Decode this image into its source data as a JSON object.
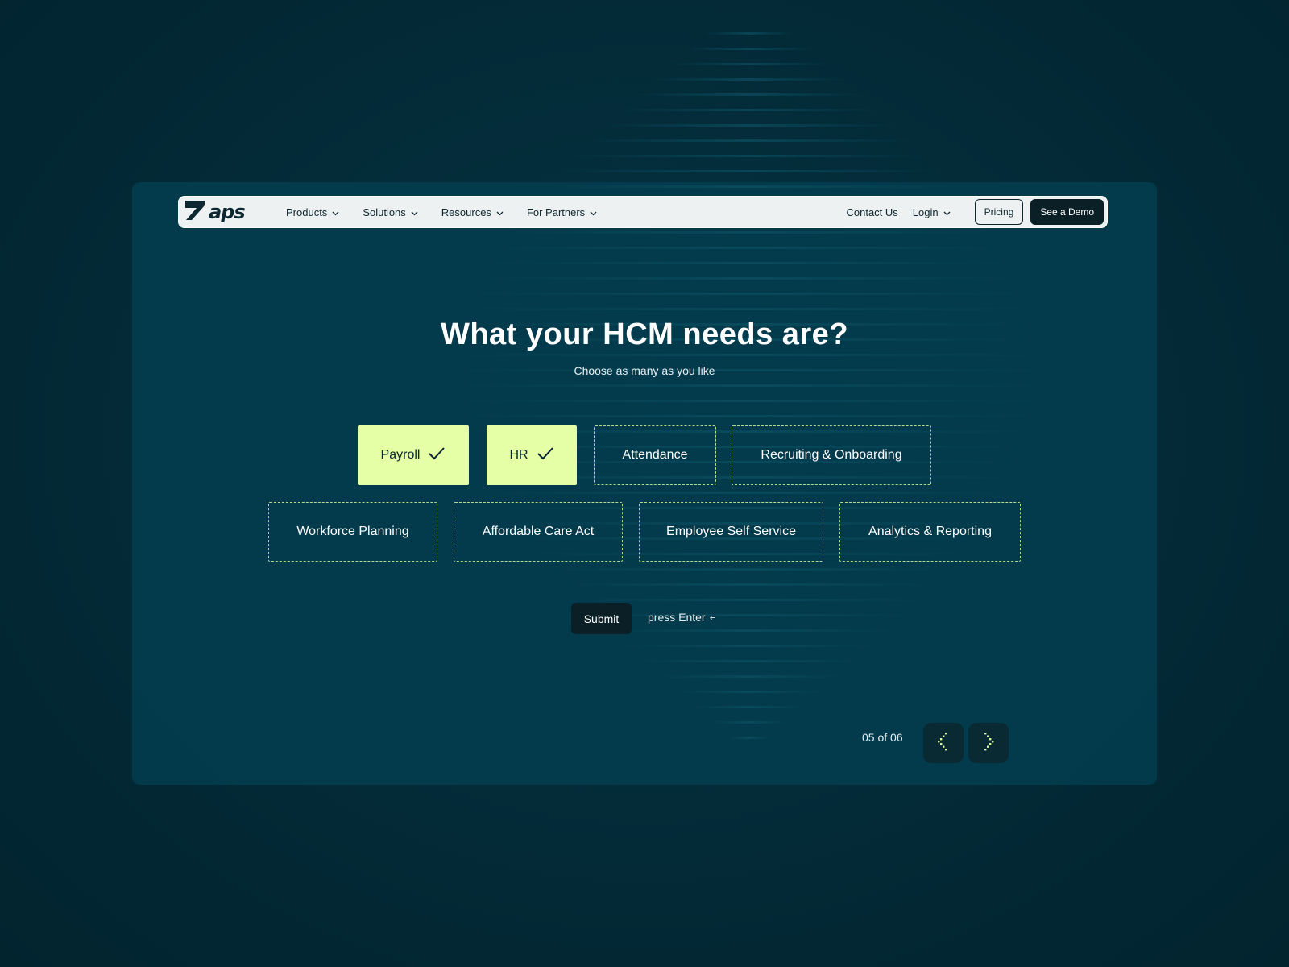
{
  "brand": {
    "name": "aps"
  },
  "nav": {
    "items": [
      {
        "label": "Products"
      },
      {
        "label": "Solutions"
      },
      {
        "label": "Resources"
      },
      {
        "label": "For Partners"
      }
    ],
    "contact_label": "Contact Us",
    "login_label": "Login",
    "pricing_label": "Pricing",
    "demo_label": "See a Demo"
  },
  "question": {
    "title": "What your HCM needs are?",
    "subtitle": "Choose as many as you like"
  },
  "options": [
    {
      "label": "Payroll",
      "selected": true
    },
    {
      "label": "HR",
      "selected": true
    },
    {
      "label": "Attendance",
      "selected": false
    },
    {
      "label": "Recruiting & Onboarding",
      "selected": false
    },
    {
      "label": "Workforce Planning",
      "selected": false
    },
    {
      "label": "Affordable Care Act",
      "selected": false
    },
    {
      "label": "Employee Self Service",
      "selected": false
    },
    {
      "label": "Analytics & Reporting",
      "selected": false
    }
  ],
  "submit": {
    "label": "Submit",
    "hint": "press Enter",
    "hint_icon": "↵"
  },
  "pager": {
    "label": "05 of 06"
  },
  "colors": {
    "background": "#032b38",
    "card": "#033c4e",
    "accent": "#e4ffa6",
    "dark_button": "#0a1f26",
    "nav_bg": "#eef1f2"
  }
}
